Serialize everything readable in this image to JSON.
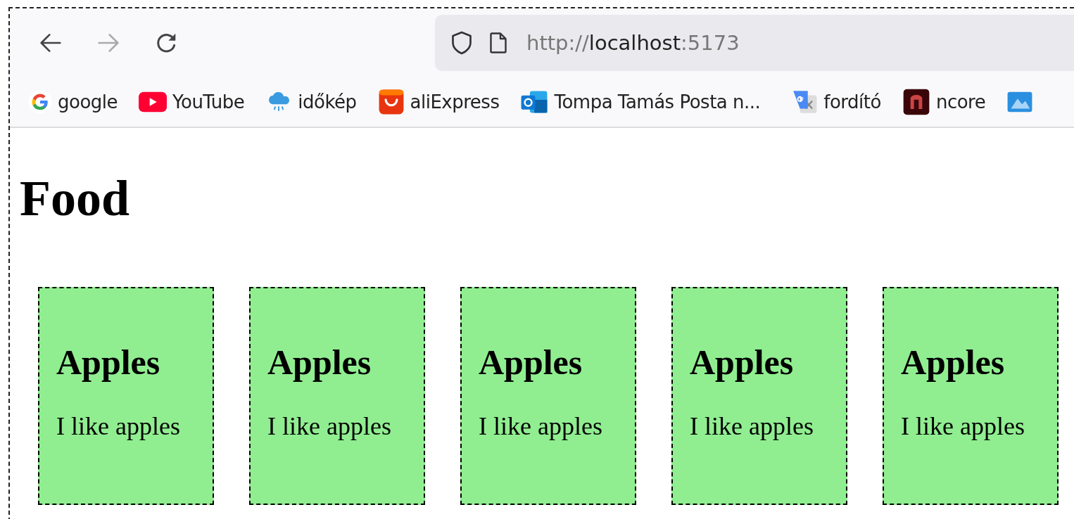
{
  "toolbar": {
    "nav": [
      {
        "kind": "back",
        "disabled": false
      },
      {
        "kind": "forward",
        "disabled": true
      },
      {
        "kind": "reload",
        "disabled": false
      }
    ],
    "url": {
      "scheme": "http://",
      "host": "localhost",
      "port": ":5173"
    }
  },
  "bookmarks": [
    {
      "kind": "google",
      "label": "google"
    },
    {
      "kind": "youtube",
      "label": "YouTube"
    },
    {
      "kind": "weather",
      "label": "időkép"
    },
    {
      "kind": "shop",
      "label": "aliExpress"
    },
    {
      "kind": "mail",
      "label": "Tompa Tamás Posta n..."
    },
    {
      "kind": "translate",
      "label": "fordító"
    },
    {
      "kind": "ncore",
      "label": "ncore"
    },
    {
      "kind": "map"
    }
  ],
  "page": {
    "title": "Food",
    "cards": [
      {
        "title": "Apples",
        "text": "I like apples"
      },
      {
        "title": "Apples",
        "text": "I like apples"
      },
      {
        "title": "Apples",
        "text": "I like apples"
      },
      {
        "title": "Apples",
        "text": "I like apples"
      },
      {
        "title": "Apples",
        "text": "I like apples"
      }
    ]
  }
}
